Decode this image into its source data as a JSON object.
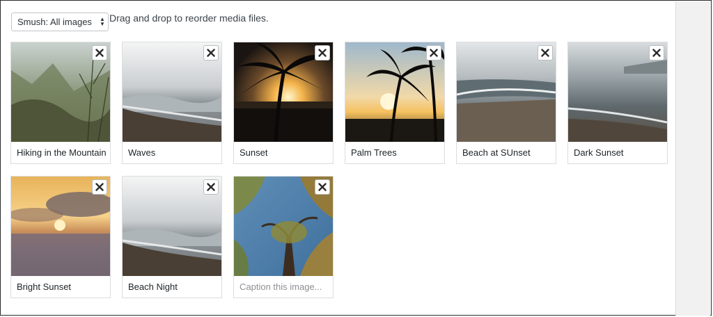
{
  "toolbar": {
    "smush_select_value": "Smush: All images",
    "hint": "Drag and drop to reorder media files."
  },
  "gallery": {
    "items": [
      {
        "caption": "Hiking in the Mountain",
        "image": "mountain-grass"
      },
      {
        "caption": "Waves",
        "image": "beach-waves"
      },
      {
        "caption": "Sunset",
        "image": "palm-sunset-dark"
      },
      {
        "caption": "Palm Trees",
        "image": "palm-sunset"
      },
      {
        "caption": "Beach at SUnset",
        "image": "beach-grey"
      },
      {
        "caption": "Dark Sunset",
        "image": "beach-dark"
      },
      {
        "caption": "Bright Sunset",
        "image": "ocean-sunset"
      },
      {
        "caption": "Beach Night",
        "image": "beach-waves"
      },
      {
        "caption": "Caption this image...",
        "image": "tree-sky",
        "placeholder": true
      }
    ]
  },
  "icons": {
    "remove": "close-icon",
    "select_arrows": "up-down-arrows-icon"
  }
}
